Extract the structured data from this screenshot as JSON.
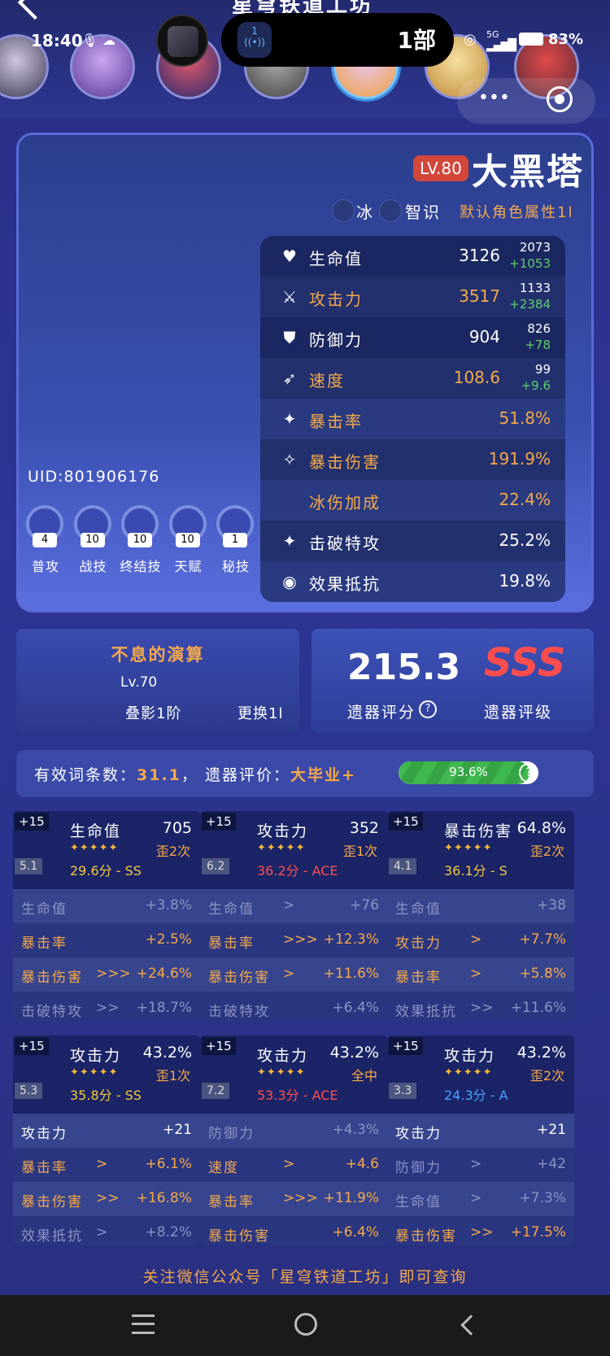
{
  "header": {
    "title": "星穹铁道工坊"
  },
  "status": {
    "time": "18:40",
    "island_text": "1部",
    "island_icon": "1",
    "battery": "83%",
    "signal": "5G"
  },
  "character": {
    "level": "LV.80",
    "name": "大黑塔",
    "element": "冰",
    "path": "智识",
    "default_attr": "默认角色属性1l",
    "uid": "UID:801906176",
    "attributes": [
      {
        "icon": "♥",
        "label": "生命值",
        "value": "3126",
        "base": "2073",
        "bonus": "+1053",
        "color": "white"
      },
      {
        "icon": "⚔",
        "label": "攻击力",
        "value": "3517",
        "base": "1133",
        "bonus": "+2384",
        "color": "orange"
      },
      {
        "icon": "⛊",
        "label": "防御力",
        "value": "904",
        "base": "826",
        "bonus": "+78",
        "color": "white"
      },
      {
        "icon": "➶",
        "label": "速度",
        "value": "108.6",
        "base": "99",
        "bonus": "+9.6",
        "color": "orange"
      },
      {
        "icon": "✦",
        "label": "暴击率",
        "value": "51.8%",
        "color": "orange"
      },
      {
        "icon": "✧",
        "label": "暴击伤害",
        "value": "191.9%",
        "color": "orange"
      },
      {
        "icon": "",
        "label": "冰伤加成",
        "value": "22.4%",
        "color": "orange"
      },
      {
        "icon": "✦",
        "label": "击破特攻",
        "value": "25.2%",
        "color": "white"
      },
      {
        "icon": "◉",
        "label": "效果抵抗",
        "value": "19.8%",
        "color": "white"
      }
    ],
    "skills": [
      {
        "name": "普攻",
        "level": "4"
      },
      {
        "name": "战技",
        "level": "10"
      },
      {
        "name": "终结技",
        "level": "10"
      },
      {
        "name": "天赋",
        "level": "10"
      },
      {
        "name": "秘技",
        "level": "1"
      }
    ]
  },
  "light_cone": {
    "name": "不息的演算",
    "level": "Lv.70",
    "superimpose": "叠影1阶",
    "change": "更换1l"
  },
  "relic_score": {
    "score": "215.3",
    "score_label": "遗器评分",
    "help": "?",
    "grade": "SSS",
    "grade_label": "遗器评级"
  },
  "effective": {
    "label_prefix": "有效词条数：",
    "count": "31.1",
    "sep": "，",
    "eval_prefix": "遗器评价：",
    "eval": "大毕业+",
    "progress_text": "93.6%",
    "progress": 0.936,
    "help": "?"
  },
  "relics": [
    {
      "plus": "+15",
      "type": "5.1",
      "main": "生命值",
      "main_value": "705",
      "stars": "✦✦✦✦✦",
      "times": "歪2次",
      "score": "29.6分 - SS",
      "score_color": "#f5c842",
      "subs": [
        {
          "label": "生命值",
          "arrows": "",
          "value": "+3.8%",
          "dim": true
        },
        {
          "label": "暴击率",
          "arrows": "",
          "value": "+2.5%",
          "dim": false
        },
        {
          "label": "暴击伤害",
          "arrows": ">>>",
          "value": "+24.6%",
          "dim": false
        },
        {
          "label": "击破特攻",
          "arrows": ">>",
          "value": "+18.7%",
          "dim": true
        }
      ]
    },
    {
      "plus": "+15",
      "type": "6.2",
      "main": "攻击力",
      "main_value": "352",
      "stars": "✦✦✦✦✦",
      "times": "歪1次",
      "score": "36.2分 - ACE",
      "score_color": "#ff4d4d",
      "subs": [
        {
          "label": "生命值",
          "arrows": ">",
          "value": "+76",
          "dim": true
        },
        {
          "label": "暴击率",
          "arrows": ">>>",
          "value": "+12.3%",
          "dim": false
        },
        {
          "label": "暴击伤害",
          "arrows": ">",
          "value": "+11.6%",
          "dim": false
        },
        {
          "label": "击破特攻",
          "arrows": "",
          "value": "+6.4%",
          "dim": true
        }
      ]
    },
    {
      "plus": "+15",
      "type": "4.1",
      "main": "暴击伤害",
      "main_value": "64.8%",
      "stars": "✦✦✦✦✦",
      "times": "歪2次",
      "score": "36.1分 - S",
      "score_color": "#f5c842",
      "subs": [
        {
          "label": "生命值",
          "arrows": "",
          "value": "+38",
          "dim": true
        },
        {
          "label": "攻击力",
          "arrows": ">",
          "value": "+7.7%",
          "dim": false
        },
        {
          "label": "暴击率",
          "arrows": ">",
          "value": "+5.8%",
          "dim": false
        },
        {
          "label": "效果抵抗",
          "arrows": ">>",
          "value": "+11.6%",
          "dim": true
        }
      ]
    },
    {
      "plus": "+15",
      "type": "5.3",
      "main": "攻击力",
      "main_value": "43.2%",
      "stars": "✦✦✦✦✦",
      "times": "歪1次",
      "score": "35.8分 - SS",
      "score_color": "#f5c842",
      "subs": [
        {
          "label": "攻击力",
          "arrows": "",
          "value": "+21",
          "dim": false,
          "white": true
        },
        {
          "label": "暴击率",
          "arrows": ">",
          "value": "+6.1%",
          "dim": false
        },
        {
          "label": "暴击伤害",
          "arrows": ">>",
          "value": "+16.8%",
          "dim": false
        },
        {
          "label": "效果抵抗",
          "arrows": ">",
          "value": "+8.2%",
          "dim": true
        }
      ]
    },
    {
      "plus": "+15",
      "type": "7.2",
      "main": "攻击力",
      "main_value": "43.2%",
      "stars": "✦✦✦✦✦",
      "times": "全中",
      "score": "53.3分 - ACE",
      "score_color": "#ff4d4d",
      "subs": [
        {
          "label": "防御力",
          "arrows": "",
          "value": "+4.3%",
          "dim": true
        },
        {
          "label": "速度",
          "arrows": ">",
          "value": "+4.6",
          "dim": false
        },
        {
          "label": "暴击率",
          "arrows": ">>>",
          "value": "+11.9%",
          "dim": false
        },
        {
          "label": "暴击伤害",
          "arrows": "",
          "value": "+6.4%",
          "dim": false
        }
      ]
    },
    {
      "plus": "+15",
      "type": "3.3",
      "main": "攻击力",
      "main_value": "43.2%",
      "stars": "✦✦✦✦✦",
      "times": "歪2次",
      "score": "24.3分 - A",
      "score_color": "#4aa3ff",
      "subs": [
        {
          "label": "攻击力",
          "arrows": "",
          "value": "+21",
          "dim": false,
          "white": true
        },
        {
          "label": "防御力",
          "arrows": ">",
          "value": "+42",
          "dim": true
        },
        {
          "label": "生命值",
          "arrows": ">",
          "value": "+7.3%",
          "dim": true
        },
        {
          "label": "暴击伤害",
          "arrows": ">>",
          "value": "+17.5%",
          "dim": false
        }
      ]
    }
  ],
  "footer": "关注微信公众号「星穹铁道工坊」即可查询",
  "colors": {
    "accent_orange": "#f5a94a",
    "green": "#5fd06a",
    "sss": "#ff4d4d"
  }
}
